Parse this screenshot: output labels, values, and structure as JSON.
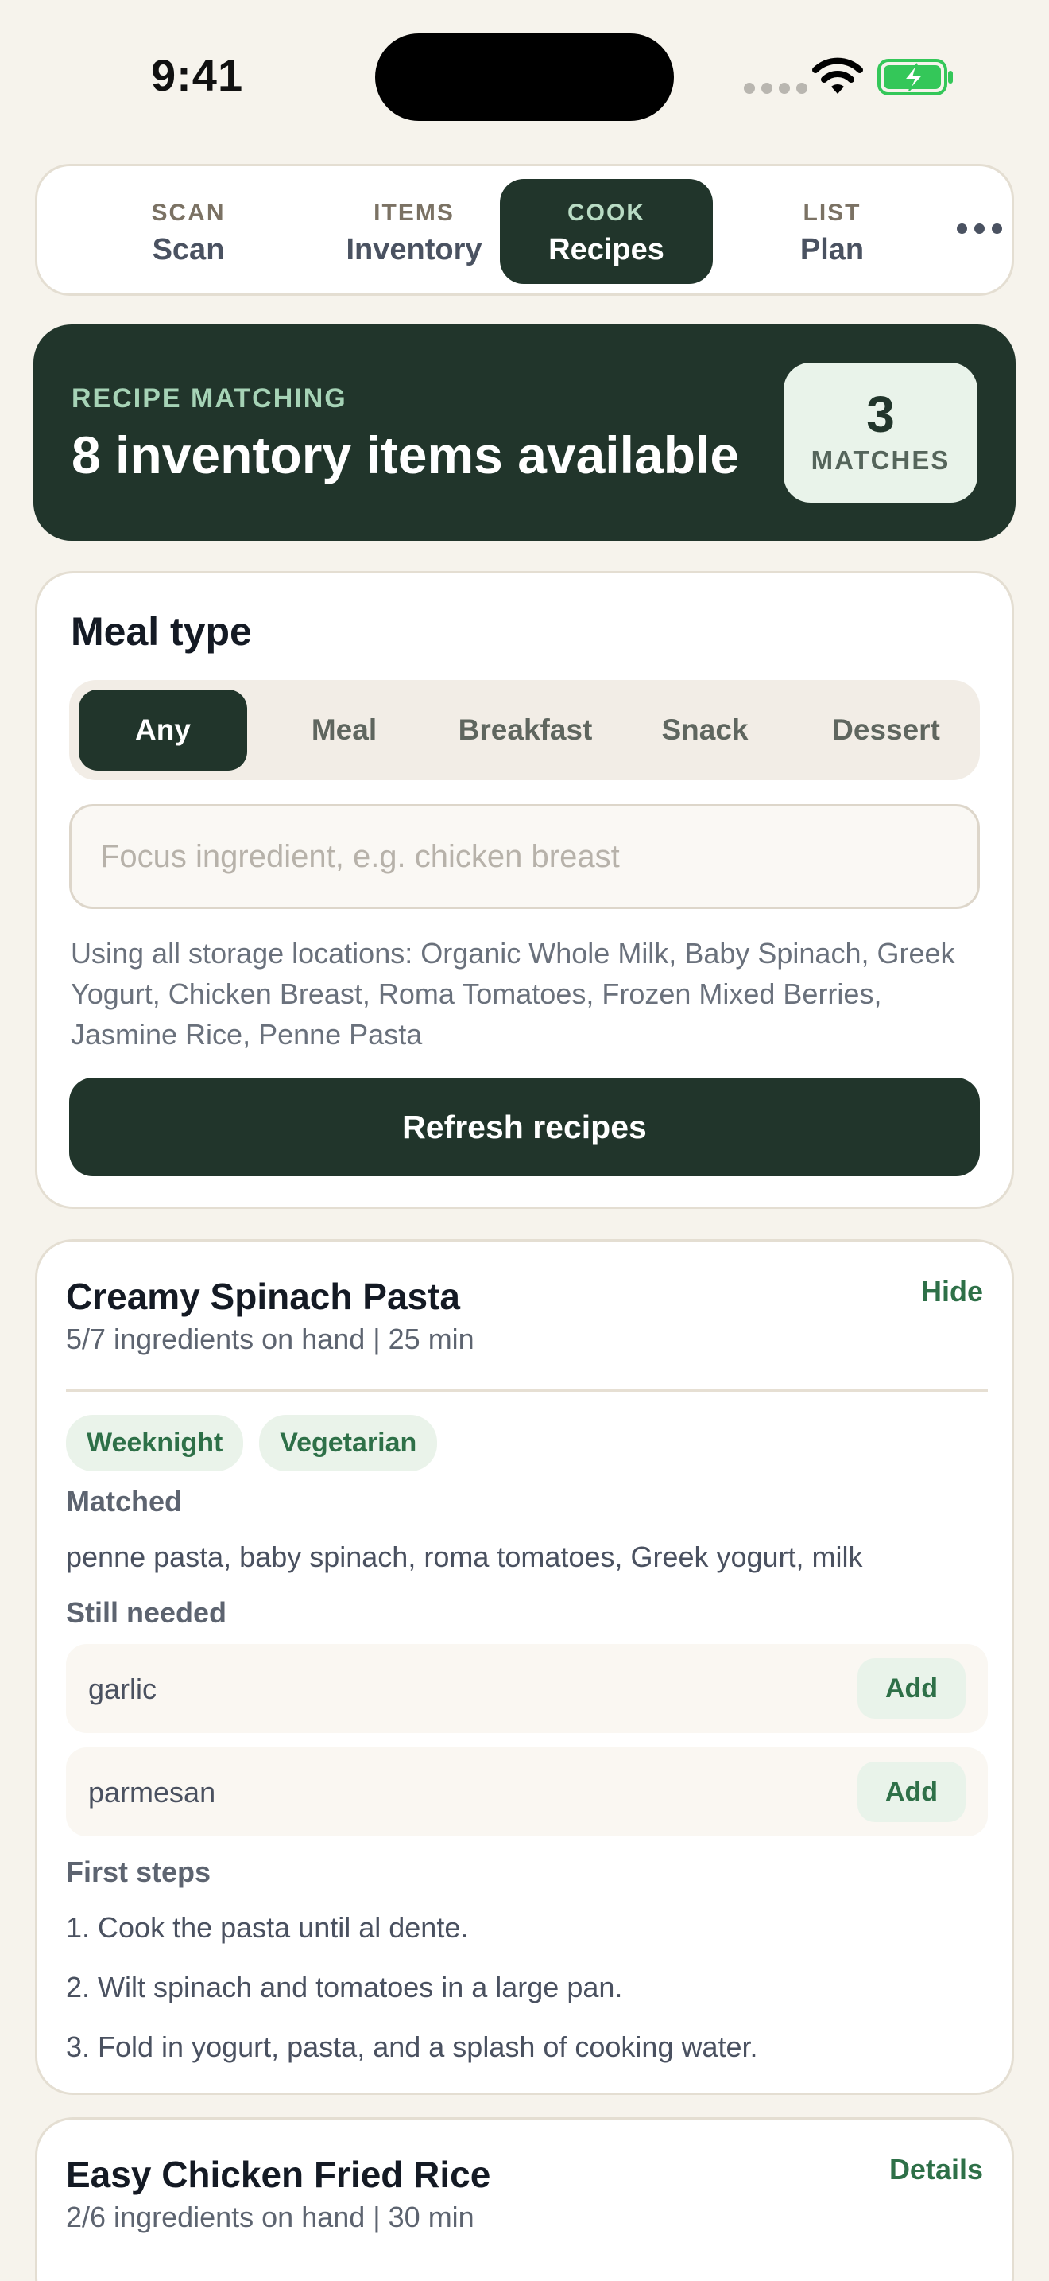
{
  "status_bar": {
    "time": "9:41"
  },
  "nav": {
    "tabs": [
      {
        "kicker": "SCAN",
        "label": "Scan",
        "active": false
      },
      {
        "kicker": "ITEMS",
        "label": "Inventory",
        "active": false
      },
      {
        "kicker": "COOK",
        "label": "Recipes",
        "active": true
      },
      {
        "kicker": "LIST",
        "label": "Plan",
        "active": false
      }
    ],
    "more_icon": "ellipsis-icon"
  },
  "banner": {
    "kicker": "RECIPE MATCHING",
    "title": "8 inventory items available",
    "matches_count": "3",
    "matches_label": "MATCHES"
  },
  "filters": {
    "title": "Meal type",
    "meal_types": [
      "Any",
      "Meal",
      "Breakfast",
      "Snack",
      "Dessert"
    ],
    "selected_meal_type": "Any",
    "focus_placeholder": "Focus ingredient, e.g. chicken breast",
    "focus_value": "",
    "storage_note": "Using all storage locations: Organic Whole Milk, Baby Spinach, Greek Yogurt, Chicken Breast, Roma Tomatoes, Frozen Mixed Berries, Jasmine Rice, Penne Pasta",
    "refresh_label": "Refresh recipes"
  },
  "recipes": [
    {
      "title": "Creamy Spinach Pasta",
      "meta": "5/7 ingredients on hand | 25 min",
      "action": "Hide",
      "tags": [
        "Weeknight",
        "Vegetarian"
      ],
      "matched_label": "Matched",
      "matched": "penne pasta, baby spinach, roma tomatoes, Greek yogurt, milk",
      "needed_label": "Still needed",
      "needed": [
        {
          "name": "garlic",
          "add_label": "Add"
        },
        {
          "name": "parmesan",
          "add_label": "Add"
        }
      ],
      "steps_label": "First steps",
      "steps": [
        "1. Cook the pasta until al dente.",
        "2. Wilt spinach and tomatoes in a large pan.",
        "3. Fold in yogurt, pasta, and a splash of cooking water."
      ]
    },
    {
      "title": "Easy Chicken Fried Rice",
      "meta": "2/6 ingredients on hand | 30 min",
      "action": "Details"
    }
  ],
  "colors": {
    "background": "#f6f3ec",
    "primary_dark": "#21352b",
    "accent_green": "#2e7048",
    "tag_bg": "#eaf3ea",
    "battery_green": "#34c759"
  }
}
